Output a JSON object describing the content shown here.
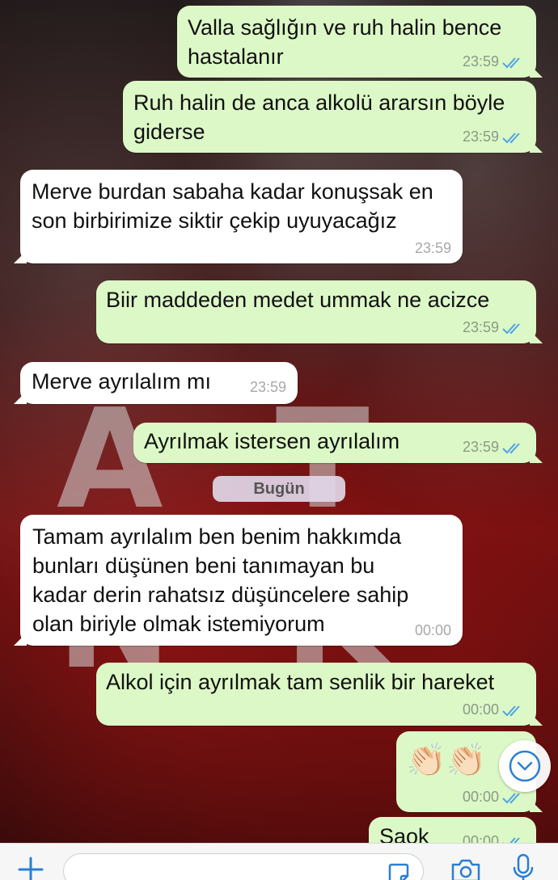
{
  "chat": {
    "messages": [
      {
        "text_lines": [
          "Valla sağlığın ve ruh halin bence",
          "hastalanır"
        ],
        "time": "23:59"
      },
      {
        "text_lines": [
          "Ruh halin de anca alkolü ararsın böyle",
          "giderse"
        ],
        "time": "23:59"
      },
      {
        "text_lines": [
          "Merve burdan sabaha kadar konuşsak en",
          "son birbirimize siktir çekip uyuyacağız"
        ],
        "time": "23:59"
      },
      {
        "text_lines": [
          "Biir maddeden medet ummak ne acizce"
        ],
        "time": "23:59"
      },
      {
        "text_lines": [
          "Merve ayrılalım mı"
        ],
        "time": "23:59"
      },
      {
        "text_lines": [
          "Ayrılmak istersen ayrılalım"
        ],
        "time": "23:59"
      },
      {
        "text_lines": [
          "Tamam ayrılalım ben benim hakkımda",
          "bunları düşünen beni tanımayan bu",
          "kadar derin rahatsız düşüncelere sahip",
          "olan biriyle olmak istemiyorum"
        ],
        "time": "00:00"
      },
      {
        "text_lines": [
          "Alkol için ayrılmak tam senlik bir hareket"
        ],
        "time": "00:00"
      },
      {
        "text_lines": [
          "👏🏻👏🏻"
        ],
        "time": "00:00"
      },
      {
        "text_lines": [
          "Saok"
        ],
        "time": "00:00"
      }
    ],
    "date_separator": "Bugün"
  },
  "icons": {
    "read_receipt": "double-check-icon",
    "scroll_down": "chevron-down-icon",
    "attach": "plus-icon",
    "sticker": "sticker-icon",
    "camera": "camera-icon",
    "mic": "mic-icon"
  },
  "colors": {
    "outgoing_bubble": "#dcf8c6",
    "incoming_bubble": "#ffffff",
    "read_tick": "#4fa3e6",
    "accent_blue": "#2a7fd4"
  }
}
